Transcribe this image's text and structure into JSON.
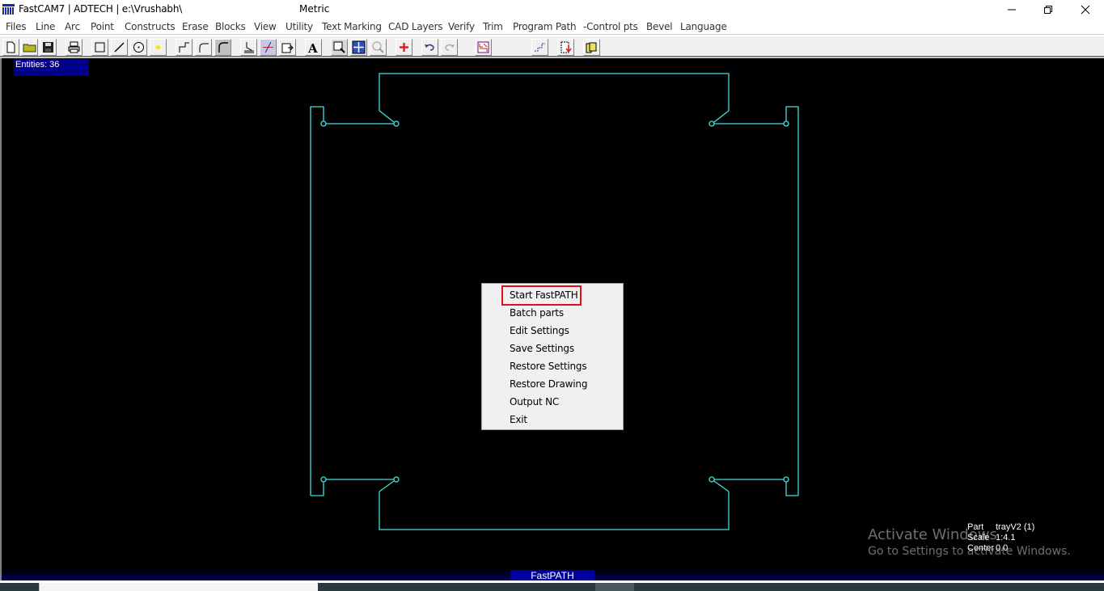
{
  "window": {
    "title": "FastCAM7 | ADTECH | e:\\Vrushabh\\",
    "units": "Metric",
    "controls": [
      "minimize",
      "restore",
      "close"
    ]
  },
  "menubar": {
    "items": [
      "Files",
      "Line",
      "Arc",
      "Point",
      "Constructs",
      "Erase",
      "Blocks",
      "View",
      "Utility",
      "Text Marking",
      "CAD Layers",
      "Verify",
      "Trim",
      "Program Path",
      "-Control pts",
      "Bevel",
      "Language"
    ]
  },
  "toolbar": {
    "buttons": [
      {
        "icon": "new-file-icon"
      },
      {
        "icon": "open-folder-icon"
      },
      {
        "icon": "save-disk-icon"
      },
      {
        "icon": "print-icon"
      },
      {
        "icon": "rectangle-icon"
      },
      {
        "icon": "line-icon"
      },
      {
        "icon": "circle-icon"
      },
      {
        "icon": "point-icon"
      },
      {
        "icon": "step-corner-icon"
      },
      {
        "icon": "fillet-corner-icon"
      },
      {
        "icon": "rounded-corner-icon"
      },
      {
        "icon": "hand-cut-icon"
      },
      {
        "icon": "trim-icon"
      },
      {
        "icon": "export-icon"
      },
      {
        "icon": "text-icon"
      },
      {
        "icon": "zoom-window-icon"
      },
      {
        "icon": "zoom-extents-icon"
      },
      {
        "icon": "zoom-previous-icon"
      },
      {
        "icon": "add-point-icon"
      },
      {
        "icon": "undo-icon"
      },
      {
        "icon": "redo-icon"
      },
      {
        "icon": "layers-icon"
      },
      {
        "icon": "path-icon"
      },
      {
        "icon": "nc-output-icon"
      },
      {
        "icon": "folder-output-icon"
      }
    ]
  },
  "canvas": {
    "entities_label": "Entities: 36",
    "geometry_color": "#40e0e0",
    "background": "#000000"
  },
  "context_menu": {
    "items": [
      "Start FastPATH",
      "Batch parts",
      "Edit Settings",
      "Save Settings",
      "Restore Settings",
      "Restore Drawing",
      "Output NC",
      "Exit"
    ],
    "highlighted_index": 0,
    "highlight_color": "#e0101a"
  },
  "part_info": {
    "part_label": "Part",
    "part_value": "trayV2 (1)",
    "scale_label": "Scale",
    "scale_value": "1:4.1",
    "center_label": "Center",
    "center_value": "0.0"
  },
  "watermark": {
    "line1": "Activate Windows",
    "line2": "Go to Settings to activate Windows."
  },
  "status": {
    "mode": "FastPATH"
  }
}
